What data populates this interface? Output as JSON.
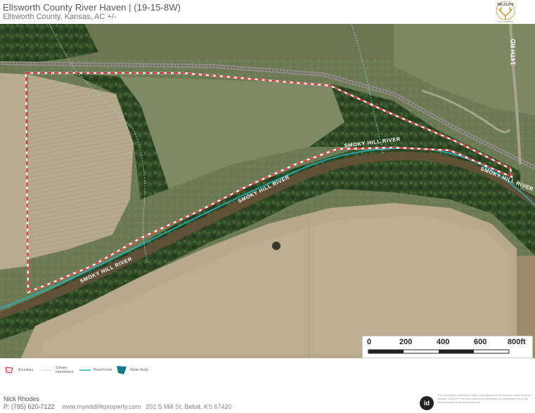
{
  "header": {
    "title": "Ellsworth County River Haven | (19-15-8W)",
    "subtitle": "Ellsworth County, Kansas,  AC +/-",
    "logo": {
      "top_text": "WILDLIFE",
      "bottom_text": "LAND COMPANY",
      "icon": "antler-icon",
      "accent_color": "#c99a2e"
    }
  },
  "map": {
    "road_label": "14TH RD",
    "river_labels": [
      "SMOKY HILL RIVER",
      "SMOKY HILL RIVER",
      "SMOKY HILL RIVER",
      "SMOKY HILL RIVER"
    ],
    "boundary_color": "#e8262d",
    "river_color": "#1fb4c8",
    "stream_color": "#7fd3e0",
    "scale": {
      "ticks": [
        "0",
        "200",
        "400",
        "600",
        "800ft"
      ]
    }
  },
  "legend": {
    "items": [
      {
        "icon": "boundary-icon",
        "label": "Boundary"
      },
      {
        "icon": "stream-icon",
        "label": "Stream,\nIntermittent"
      },
      {
        "icon": "river-icon",
        "label": "River/Creek"
      },
      {
        "icon": "water-body-icon",
        "label": "Water Body"
      }
    ]
  },
  "footer": {
    "agent_name": "Nick Rhodes",
    "agent_phone": "P: (785) 620-7122",
    "website": "www.mywildlifeproperty.com",
    "address": "202 S Mill St, Beloit, KS 67420",
    "badge": "id",
    "disclaimer": "The information contained herein was obtained from sources deemed to be reliable. Land id™ Services makes no warranties or guarantees as to the completeness or accuracy thereof."
  }
}
